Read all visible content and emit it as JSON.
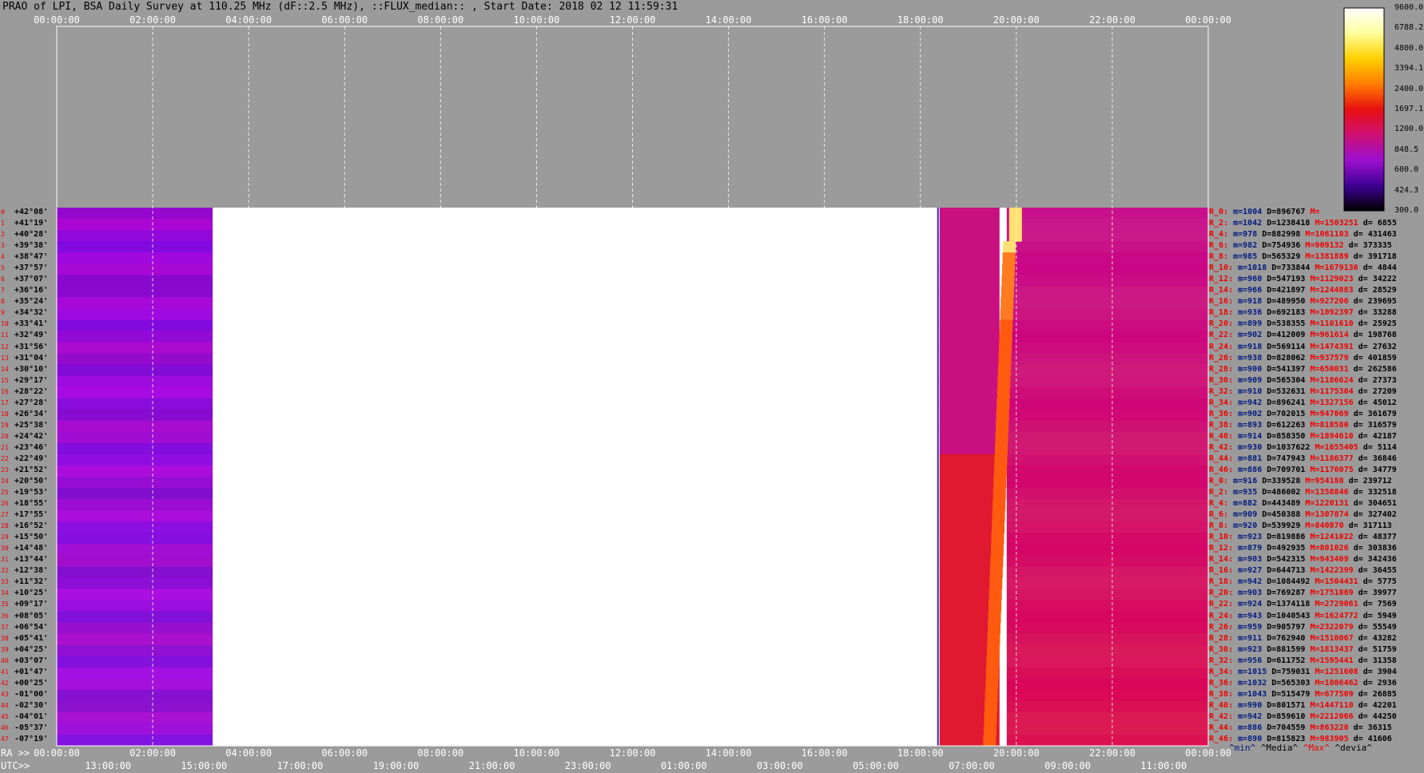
{
  "title": "PRAO of LPI, BSA Daily Survey at 110.25 MHz (dF::2.5 MHz), ::FLUX_median:: , Start Date: 2018 02 12 11:59:31",
  "top_axis_ticks": [
    "00:00:00",
    "02:00:00",
    "04:00:00",
    "06:00:00",
    "08:00:00",
    "10:00:00",
    "12:00:00",
    "14:00:00",
    "16:00:00",
    "18:00:00",
    "20:00:00",
    "22:00:00",
    "00:00:00"
  ],
  "ra_axis_label": "RA >>",
  "ra_axis_ticks": [
    "00:00:00",
    "02:00:00",
    "04:00:00",
    "06:00:00",
    "08:00:00",
    "10:00:00",
    "12:00:00",
    "14:00:00",
    "16:00:00",
    "18:00:00",
    "20:00:00",
    "22:00:00",
    "00:00:00"
  ],
  "utc_axis_label": "UTC>>",
  "utc_axis_ticks": [
    "13:00:00",
    "15:00:00",
    "17:00:00",
    "19:00:00",
    "21:00:00",
    "23:00:00",
    "01:00:00",
    "03:00:00",
    "05:00:00",
    "07:00:00",
    "09:00:00",
    "11:00:00"
  ],
  "colorbar_ticks": [
    "9600.0",
    "6788.2",
    "4800.0",
    "3394.1",
    "2400.0",
    "1697.1",
    "1200.0",
    "848.5",
    "600.0",
    "424.3",
    "300.0"
  ],
  "footer_labels": {
    "min": "^min^",
    "median": "^Media^",
    "max": "^Max^",
    "devia": "^devia^"
  },
  "chart_data": {
    "type": "heatmap",
    "title": "PRAO of LPI, BSA Daily Survey at 110.25 MHz (dF::2.5 MHz), ::FLUX_median:: , Start Date: 2018 02 12 11:59:31",
    "x_axis": "RA (hours)",
    "xlim": [
      0,
      24
    ],
    "data_gaps_ra_hours": [
      [
        3.25,
        18.4
      ],
      [
        19.65,
        19.8
      ]
    ],
    "colorbar_range": [
      300.0,
      9600.0
    ],
    "colorbar_scale": "log",
    "declinations": [
      "+42°08'",
      "+41°19'",
      "+40°28'",
      "+39°38'",
      "+38°47'",
      "+37°57'",
      "+37°07'",
      "+36°16'",
      "+35°24'",
      "+34°32'",
      "+33°41'",
      "+32°49'",
      "+31°56'",
      "+31°04'",
      "+30°10'",
      "+29°17'",
      "+28°22'",
      "+27°28'",
      "+26°34'",
      "+25°38'",
      "+24°42'",
      "+23°46'",
      "+22°49'",
      "+21°52'",
      "+20°50'",
      "+19°53'",
      "+18°55'",
      "+17°55'",
      "+16°52'",
      "+15°50'",
      "+14°48'",
      "+13°44'",
      "+12°38'",
      "+11°32'",
      "+10°25'",
      "+09°17'",
      "+08°05'",
      "+06°54'",
      "+05°41'",
      "+04°25'",
      "+03°07'",
      "+01°47'",
      "+00°25'",
      "-01°00'",
      "-02°30'",
      "-04°01'",
      "-05°37'",
      "-07°19'"
    ],
    "row_stats": [
      {
        "r": "R_0:",
        "m": "m=1004",
        "D": "D=896767",
        "M": "M=",
        "d": ""
      },
      {
        "r": "R_2:",
        "m": "m=1042",
        "D": "D=1238418",
        "M": "M=1503251",
        "d": "d= 6855"
      },
      {
        "r": "R_4:",
        "m": "m=978",
        "D": "D=882998",
        "M": "M=1061103",
        "d": "d= 431463"
      },
      {
        "r": "R_6:",
        "m": "m=982",
        "D": "D=754936",
        "M": "M=909132",
        "d": "d= 373335"
      },
      {
        "r": "R_8:",
        "m": "m=985",
        "D": "D=565329",
        "M": "M=1381889",
        "d": "d= 391718"
      },
      {
        "r": "R_10:",
        "m": "m=1018",
        "D": "D=733844",
        "M": "M=1679136",
        "d": "d= 4844"
      },
      {
        "r": "R_12:",
        "m": "m=960",
        "D": "D=547193",
        "M": "M=1129023",
        "d": "d= 34222"
      },
      {
        "r": "R_14:",
        "m": "m=966",
        "D": "D=421897",
        "M": "M=1244883",
        "d": "d= 28529"
      },
      {
        "r": "R_16:",
        "m": "m=918",
        "D": "D=489950",
        "M": "M=927206",
        "d": "d= 239695"
      },
      {
        "r": "R_18:",
        "m": "m=936",
        "D": "D=692183",
        "M": "M=1092397",
        "d": "d= 33288"
      },
      {
        "r": "R_20:",
        "m": "m=899",
        "D": "D=538355",
        "M": "M=1101610",
        "d": "d= 25925"
      },
      {
        "r": "R_22:",
        "m": "m=902",
        "D": "D=412009",
        "M": "M=961614",
        "d": "d= 198768"
      },
      {
        "r": "R_24:",
        "m": "m=918",
        "D": "D=569114",
        "M": "M=1474391",
        "d": "d= 27632"
      },
      {
        "r": "R_26:",
        "m": "m=938",
        "D": "D=828062",
        "M": "M=937579",
        "d": "d= 401859"
      },
      {
        "r": "R_28:",
        "m": "m=900",
        "D": "D=541397",
        "M": "M=650031",
        "d": "d= 262586"
      },
      {
        "r": "R_30:",
        "m": "m=909",
        "D": "D=565304",
        "M": "M=1186624",
        "d": "d= 27373"
      },
      {
        "r": "R_32:",
        "m": "m=910",
        "D": "D=532631",
        "M": "M=1175304",
        "d": "d= 27209"
      },
      {
        "r": "R_34:",
        "m": "m=942",
        "D": "D=896241",
        "M": "M=1327156",
        "d": "d= 45012"
      },
      {
        "r": "R_36:",
        "m": "m=902",
        "D": "D=702015",
        "M": "M=947069",
        "d": "d= 361679"
      },
      {
        "r": "R_38:",
        "m": "m=893",
        "D": "D=612263",
        "M": "M=818580",
        "d": "d= 316579"
      },
      {
        "r": "R_40:",
        "m": "m=914",
        "D": "D=858350",
        "M": "M=1894610",
        "d": "d= 42187"
      },
      {
        "r": "R_42:",
        "m": "m=930",
        "D": "D=1037622",
        "M": "M=1655405",
        "d": "d= 5114"
      },
      {
        "r": "R_44:",
        "m": "m=881",
        "D": "D=747943",
        "M": "M=1186377",
        "d": "d= 36846"
      },
      {
        "r": "R_46:",
        "m": "m=886",
        "D": "D=709701",
        "M": "M=1176075",
        "d": "d= 34779"
      },
      {
        "r": "R_0:",
        "m": "m=916",
        "D": "D=339528",
        "M": "M=954188",
        "d": "d= 239712"
      },
      {
        "r": "R_2:",
        "m": "m=935",
        "D": "D=486002",
        "M": "M=1358846",
        "d": "d= 332518"
      },
      {
        "r": "R_4:",
        "m": "m=882",
        "D": "D=443489",
        "M": "M=1220131",
        "d": "d= 304651"
      },
      {
        "r": "R_6:",
        "m": "m=909",
        "D": "D=450388",
        "M": "M=1307874",
        "d": "d= 327402"
      },
      {
        "r": "R_8:",
        "m": "m=920",
        "D": "D=539929",
        "M": "M=840870",
        "d": "d= 317113"
      },
      {
        "r": "R_10:",
        "m": "m=923",
        "D": "D=819886",
        "M": "M=1241022",
        "d": "d= 48377"
      },
      {
        "r": "R_12:",
        "m": "m=879",
        "D": "D=492935",
        "M": "M=801026",
        "d": "d= 303836"
      },
      {
        "r": "R_14:",
        "m": "m=903",
        "D": "D=542315",
        "M": "M=943409",
        "d": "d= 342436"
      },
      {
        "r": "R_16:",
        "m": "m=927",
        "D": "D=644713",
        "M": "M=1422399",
        "d": "d= 36455"
      },
      {
        "r": "R_18:",
        "m": "m=942",
        "D": "D=1084492",
        "M": "M=1504431",
        "d": "d= 5775"
      },
      {
        "r": "R_20:",
        "m": "m=903",
        "D": "D=769287",
        "M": "M=1751069",
        "d": "d= 39977"
      },
      {
        "r": "R_22:",
        "m": "m=924",
        "D": "D=1374118",
        "M": "M=2729061",
        "d": "d= 7569"
      },
      {
        "r": "R_24:",
        "m": "m=943",
        "D": "D=1040543",
        "M": "M=1624772",
        "d": "d= 5949"
      },
      {
        "r": "R_26:",
        "m": "m=959",
        "D": "D=905797",
        "M": "M=2322079",
        "d": "d= 55549"
      },
      {
        "r": "R_28:",
        "m": "m=911",
        "D": "D=762940",
        "M": "M=1510067",
        "d": "d= 43282"
      },
      {
        "r": "R_30:",
        "m": "m=923",
        "D": "D=881599",
        "M": "M=1813437",
        "d": "d= 51759"
      },
      {
        "r": "R_32:",
        "m": "m=956",
        "D": "D=611752",
        "M": "M=1595441",
        "d": "d= 31358"
      },
      {
        "r": "R_34:",
        "m": "m=1015",
        "D": "D=759031",
        "M": "M=1251608",
        "d": "d= 3904"
      },
      {
        "r": "R_36:",
        "m": "m=1032",
        "D": "D=565303",
        "M": "M=1006462",
        "d": "d= 2936"
      },
      {
        "r": "R_38:",
        "m": "m=1043",
        "D": "D=515479",
        "M": "M=677509",
        "d": "d= 26885"
      },
      {
        "r": "R_40:",
        "m": "m=990",
        "D": "D=801571",
        "M": "M=1447110",
        "d": "d= 42201"
      },
      {
        "r": "R_42:",
        "m": "m=942",
        "D": "D=859610",
        "M": "M=2212066",
        "d": "d= 44250"
      },
      {
        "r": "R_44:",
        "m": "m=886",
        "D": "D=704559",
        "M": "M=863220",
        "d": "d= 36315"
      },
      {
        "r": "R_46:",
        "m": "m=890",
        "D": "D=815823",
        "M": "M=983905",
        "d": "d= 41606"
      }
    ]
  }
}
